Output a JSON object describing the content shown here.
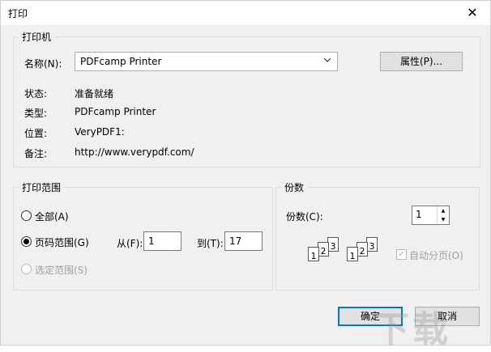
{
  "window": {
    "title": "打印",
    "close_glyph": "✕"
  },
  "printer_group": {
    "legend": "打印机",
    "name_label": "名称(N):",
    "name_value": "PDFcamp Printer",
    "properties_button": "属性(P)...",
    "status_label": "状态:",
    "status_value": "准备就绪",
    "type_label": "类型:",
    "type_value": "PDFcamp Printer",
    "location_label": "位置:",
    "location_value": "VeryPDF1:",
    "comment_label": "备注:",
    "comment_value": "http://www.verypdf.com/"
  },
  "range_group": {
    "legend": "打印范围",
    "all_label": "全部(A)",
    "pages_label": "页码范围(G)",
    "from_label": "从(F):",
    "from_value": "1",
    "to_label": "到(T):",
    "to_value": "17",
    "selection_label": "选定范围(S)",
    "selected": "pages"
  },
  "copies_group": {
    "legend": "份数",
    "copies_label": "份数(C):",
    "copies_value": "1",
    "collate_label": "自动分页(O)",
    "collate_checked": true,
    "collate_disabled": true,
    "collate_check_glyph": "✓",
    "stack1": [
      "1",
      "2",
      "3"
    ],
    "stack2": [
      "1",
      "2",
      "3"
    ]
  },
  "footer": {
    "ok_label": "确定",
    "cancel_label": "取消"
  },
  "watermark": "下载"
}
